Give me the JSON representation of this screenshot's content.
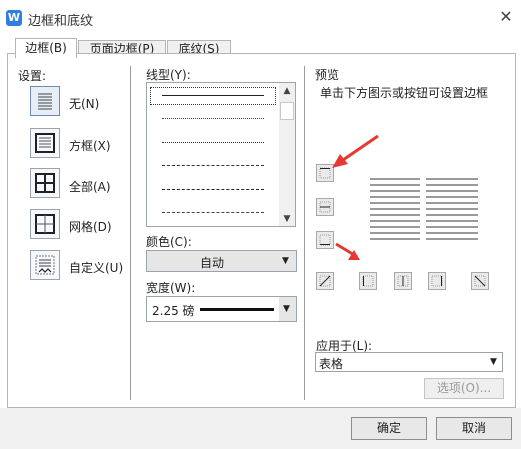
{
  "window": {
    "title": "边框和底纹",
    "app_icon": "W"
  },
  "tabs": [
    {
      "label": "边框(B)",
      "active": true
    },
    {
      "label": "页面边框(P)",
      "active": false
    },
    {
      "label": "底纹(S)",
      "active": false
    }
  ],
  "settings": {
    "heading": "设置:",
    "items": [
      {
        "label": "无(N)",
        "icon": "border-none-icon",
        "selected": true
      },
      {
        "label": "方框(X)",
        "icon": "border-box-icon",
        "selected": false
      },
      {
        "label": "全部(A)",
        "icon": "border-all-icon",
        "selected": false
      },
      {
        "label": "网格(D)",
        "icon": "border-grid-icon",
        "selected": false
      },
      {
        "label": "自定义(U)",
        "icon": "border-custom-icon",
        "selected": false
      }
    ]
  },
  "line_style": {
    "heading": "线型(Y):",
    "styles": [
      "solid",
      "dotted-fine",
      "dotted",
      "dashed-short",
      "dashed",
      "dash-dot",
      "dash-dot-dot"
    ]
  },
  "color": {
    "label": "颜色(C):",
    "value": "自动"
  },
  "width": {
    "label": "宽度(W):",
    "value": "2.25 磅"
  },
  "preview": {
    "heading": "预览",
    "hint": "单击下方图示或按钮可设置边框"
  },
  "apply_to": {
    "label": "应用于(L):",
    "value": "表格"
  },
  "buttons": {
    "options": "选项(O)...",
    "ok": "确定",
    "cancel": "取消"
  },
  "colors": {
    "accent_arrow": "#e53935",
    "icon_blue": "#2f7fe0"
  }
}
